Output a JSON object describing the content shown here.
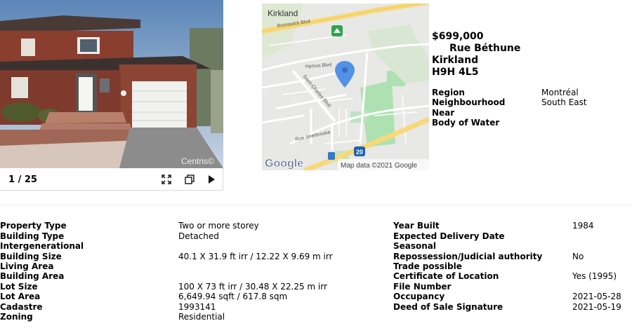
{
  "gallery": {
    "counter": "1 / 25",
    "watermark": "Centris©"
  },
  "map": {
    "labels": {
      "city": "Kirkland",
      "street1": "Brunswick Blvd",
      "street2": "Hymus Blvd",
      "street3": "Saint-Charles Blvd",
      "street4": "Rue Sherbrooke",
      "highway": "20"
    },
    "attribution": "Map data ©2021 Google",
    "logo": "Google"
  },
  "listing": {
    "price": "$699,000",
    "street": "Rue Béthune",
    "city": "Kirkland",
    "postal": "H9H 4L5",
    "info": [
      {
        "label": "Region",
        "value": "Montréal"
      },
      {
        "label": "Neighbourhood",
        "value": "South East"
      },
      {
        "label": "Near",
        "value": ""
      },
      {
        "label": "Body of Water",
        "value": ""
      }
    ]
  },
  "details_left": [
    {
      "label": "Property Type",
      "value": "Two or more storey"
    },
    {
      "label": "Building Type",
      "value": "Detached"
    },
    {
      "label": "Intergenerational",
      "value": ""
    },
    {
      "label": "Building Size",
      "value": "40.1 X 31.9 ft irr / 12.22 X 9.69 m irr"
    },
    {
      "label": "Living Area",
      "value": ""
    },
    {
      "label": "Building Area",
      "value": ""
    },
    {
      "label": "Lot Size",
      "value": "100 X 73 ft irr / 30.48 X 22.25 m irr"
    },
    {
      "label": "Lot Area",
      "value": "6,649.94 sqft / 617.8 sqm"
    },
    {
      "label": "Cadastre",
      "value": "1993141"
    },
    {
      "label": "Zoning",
      "value": "Residential"
    }
  ],
  "details_right": [
    {
      "label": "Year Built",
      "value": "1984"
    },
    {
      "label": "Expected Delivery Date",
      "value": ""
    },
    {
      "label": "Seasonal",
      "value": ""
    },
    {
      "label": "Repossession/Judicial authority",
      "value": "No"
    },
    {
      "label": "Trade possible",
      "value": ""
    },
    {
      "label": "Certificate of Location",
      "value": "Yes (1995)"
    },
    {
      "label": "File Number",
      "value": ""
    },
    {
      "label": "Occupancy",
      "value": "2021-05-28"
    },
    {
      "label": "Deed of Sale Signature",
      "value": "2021-05-19"
    }
  ]
}
